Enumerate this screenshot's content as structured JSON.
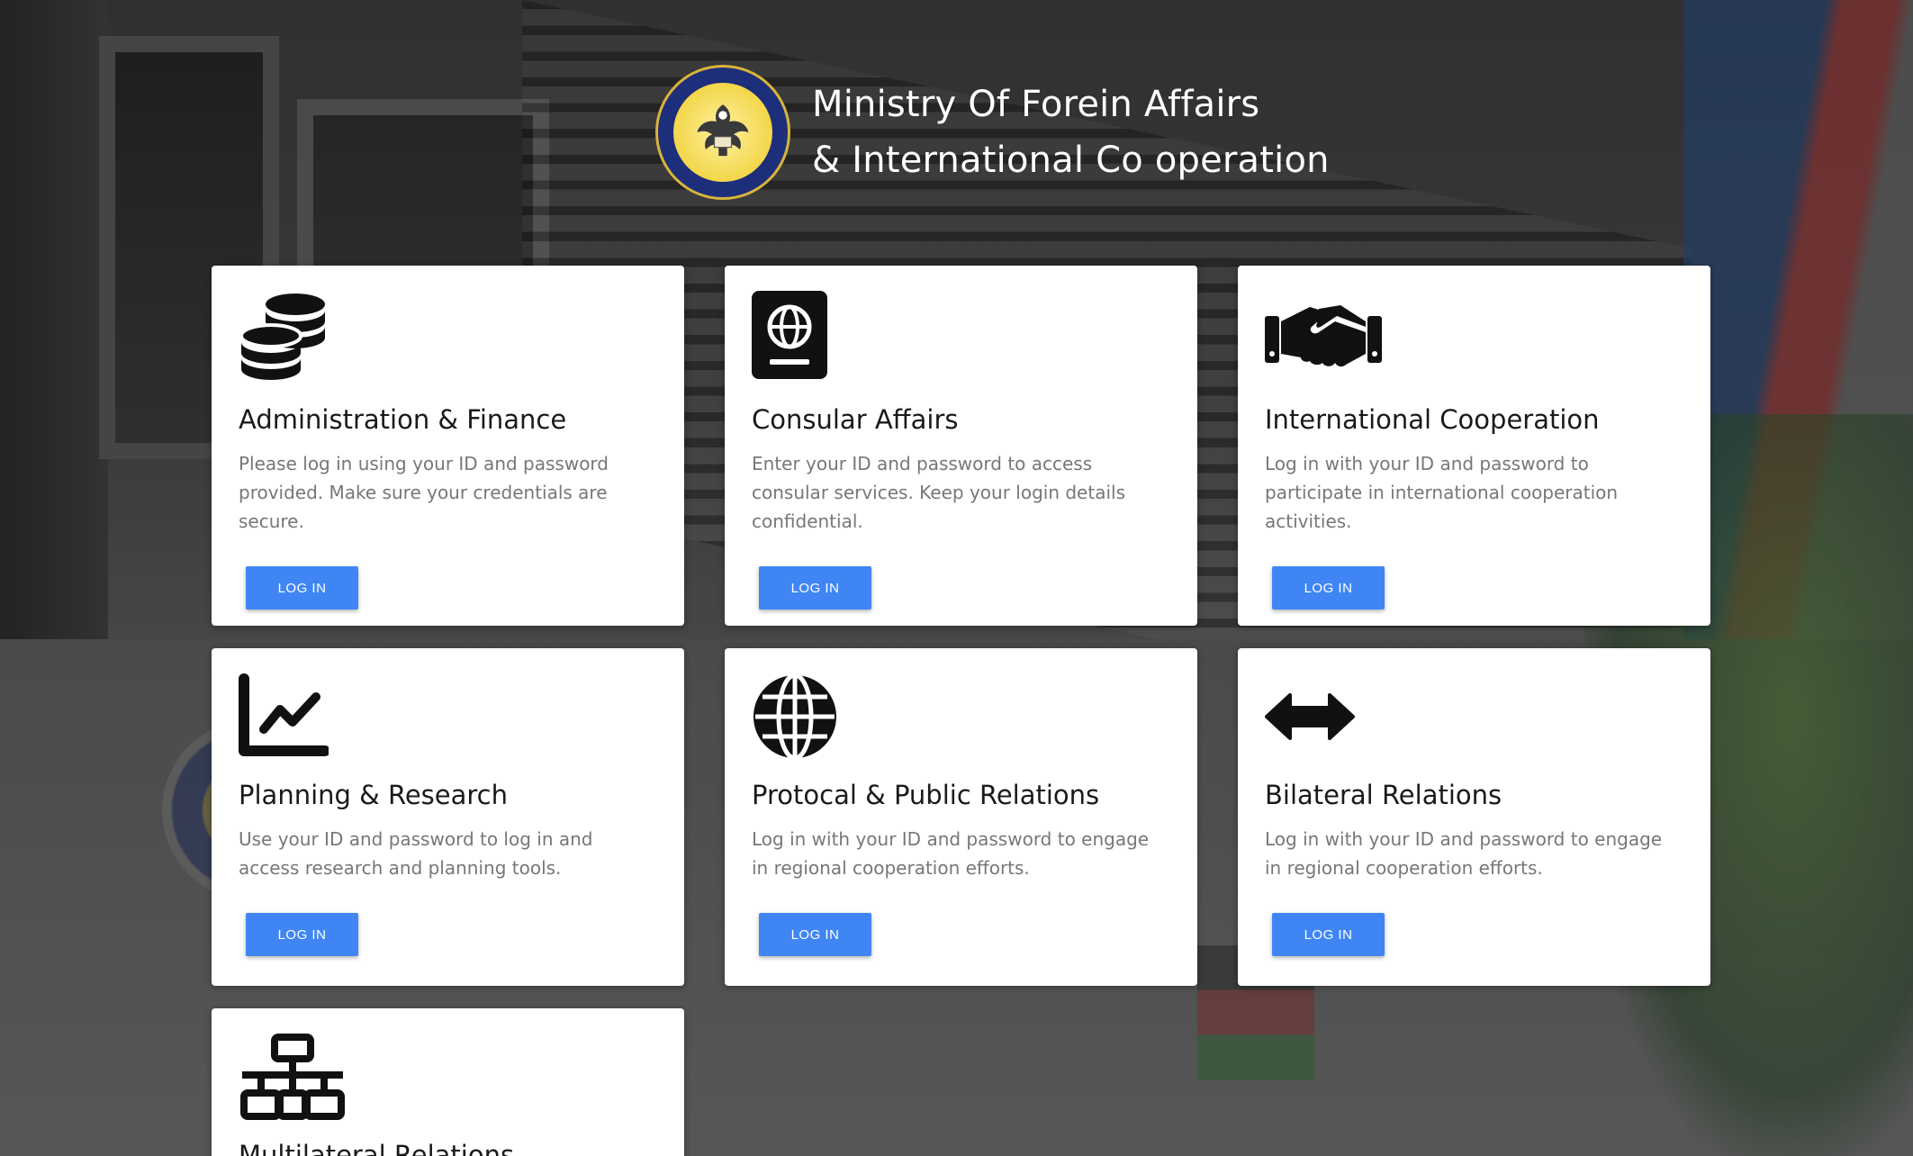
{
  "header": {
    "title_line1": "Ministry Of Forein Affairs",
    "title_line2": "& International Co operation",
    "seal_icon": "south-sudan-coat-of-arms-icon"
  },
  "colors": {
    "button_bg": "#3f86f4",
    "button_text": "#ffffff",
    "card_bg": "#ffffff",
    "title_text": "#1a1a1a",
    "desc_text": "#777777"
  },
  "cards": [
    {
      "icon": "coins-icon",
      "title": "Administration & Finance",
      "description": "Please log in using your ID and password provided. Make sure your credentials are secure.",
      "button": "LOG IN"
    },
    {
      "icon": "passport-icon",
      "title": "Consular Affairs",
      "description": "Enter your ID and password to access consular services. Keep your login details confidential.",
      "button": "LOG IN"
    },
    {
      "icon": "handshake-icon",
      "title": "International Cooperation",
      "description": "Log in with your ID and password to participate in international cooperation activities.",
      "button": "LOG IN"
    },
    {
      "icon": "line-chart-icon",
      "title": "Planning & Research",
      "description": "Use your ID and password to log in and access research and planning tools.",
      "button": "LOG IN"
    },
    {
      "icon": "globe-icon",
      "title": "Protocal & Public Relations",
      "description": "Log in with your ID and password to engage in regional cooperation efforts.",
      "button": "LOG IN"
    },
    {
      "icon": "arrows-left-right-icon",
      "title": "Bilateral Relations",
      "description": "Log in with your ID and password to engage in regional cooperation efforts.",
      "button": "LOG IN"
    },
    {
      "icon": "network-icon",
      "title": "Multilateral Relations"
    }
  ]
}
